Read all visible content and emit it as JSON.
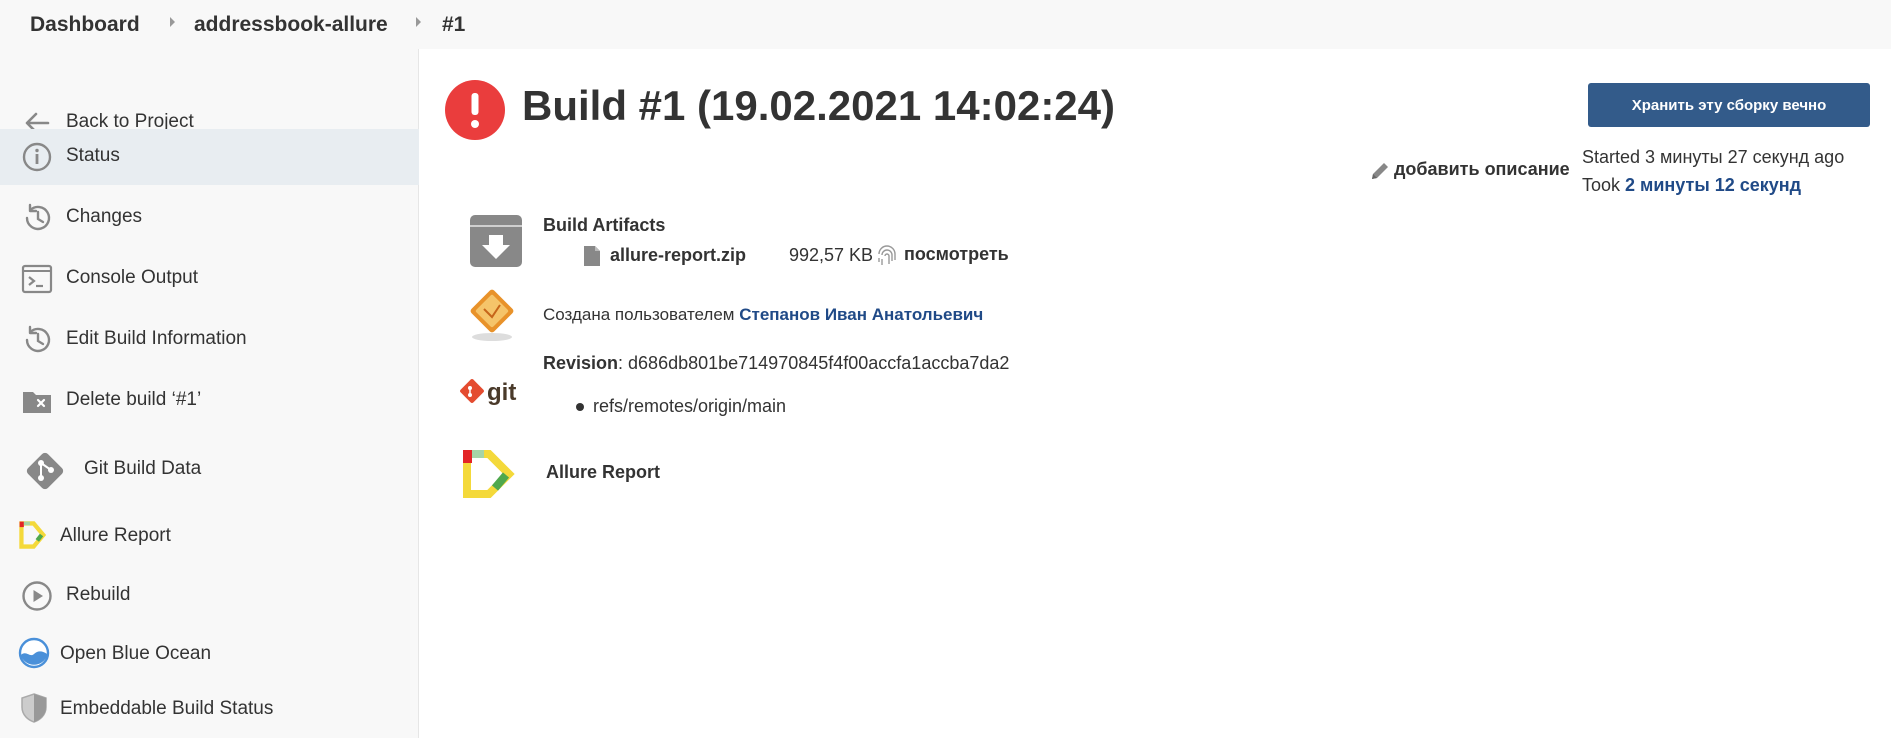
{
  "breadcrumb": {
    "dashboard": "Dashboard",
    "project": "addressbook-allure",
    "build": "#1"
  },
  "sidebar": {
    "items": [
      {
        "label": "Back to Project",
        "icon": "arrow-left-icon"
      },
      {
        "label": "Status",
        "icon": "info-icon",
        "active": true
      },
      {
        "label": "Changes",
        "icon": "history-icon"
      },
      {
        "label": "Console Output",
        "icon": "terminal-icon"
      },
      {
        "label": "Edit Build Information",
        "icon": "history-icon"
      },
      {
        "label": "Delete build ‘#1’",
        "icon": "folder-delete-icon"
      },
      {
        "label": "Git Build Data",
        "icon": "git-icon"
      },
      {
        "label": "Allure Report",
        "icon": "allure-icon"
      },
      {
        "label": "Rebuild",
        "icon": "play-circle-icon"
      },
      {
        "label": "Open Blue Ocean",
        "icon": "blue-ocean-icon"
      },
      {
        "label": "Embeddable Build Status",
        "icon": "shield-icon"
      }
    ]
  },
  "main": {
    "title": "Build #1 (19.02.2021 14:02:24)",
    "keep_button": "Хранить эту сборку вечно",
    "add_description": "добавить описание",
    "started_prefix": "Started ",
    "started_value": "3 минуты 27 секунд ago",
    "took_prefix": "Took ",
    "took_value": "2 минуты 12 секунд",
    "artifacts": {
      "heading": "Build Artifacts",
      "file_name": "allure-report.zip",
      "file_size": "992,57 KB",
      "view_link": "посмотреть"
    },
    "cause": {
      "prefix": "Создана пользователем ",
      "user": "Степанов Иван Анатольевич"
    },
    "git": {
      "revision_label": "Revision",
      "revision_value": ": d686db801be714970845f4f00accfa1accba7da2",
      "branch": "refs/remotes/origin/main",
      "logo_text": "git"
    },
    "allure_link": "Allure Report"
  },
  "colors": {
    "link": "#204a87",
    "button": "#335b8a",
    "error": "#ea3d3d",
    "active_bg": "#e8edf1"
  }
}
